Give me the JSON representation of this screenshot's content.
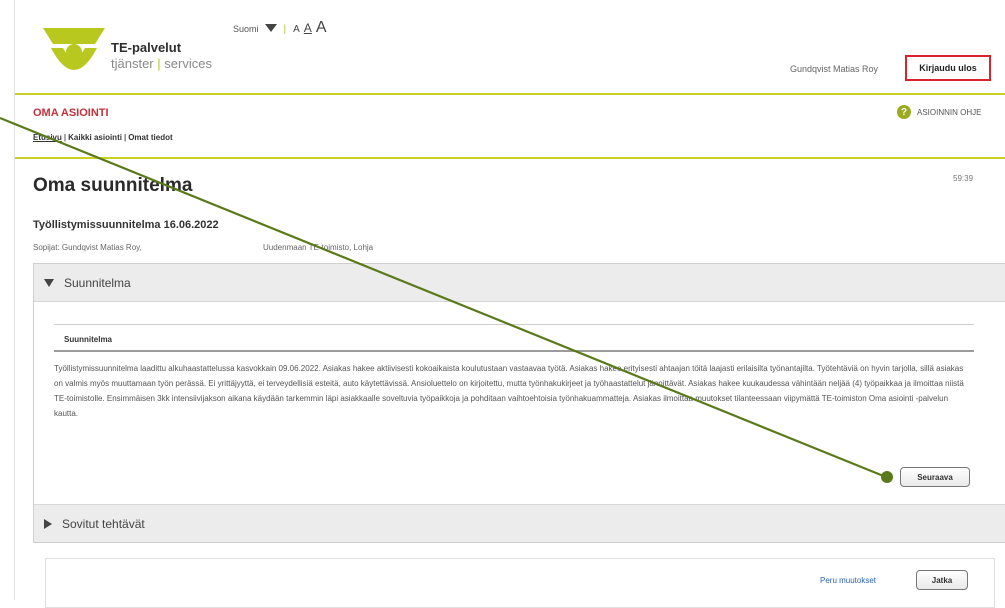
{
  "header": {
    "brand_name": "TE-palvelut",
    "brand_sub_left": "tjänster",
    "brand_sub_sep": "|",
    "brand_sub_right": "services",
    "language": "Suomi",
    "font_sizes": [
      "A",
      "A",
      "A"
    ],
    "user_name": "Gundqvist Matias Roy",
    "logout_label": "Kirjaudu ulos"
  },
  "section": {
    "title": "OMA ASIOINTI",
    "help_label": "ASIOINNIN OHJE"
  },
  "nav": {
    "items": [
      "Etusivu",
      "Kaikki asiointi",
      "Omat tiedot"
    ],
    "separator": "|"
  },
  "main": {
    "page_title": "Oma suunnitelma",
    "timer": "59:39",
    "plan_title": "Työllistymissuunnitelma 16.06.2022",
    "parties": "Sopijat: Gundqvist Matias Roy,",
    "office": "Uudenmaan TE-toimisto, Lohja"
  },
  "accordion": {
    "first_label": "Suunnitelma",
    "inner_heading": "Suunnitelma",
    "text": "Työllistymissuunnitelma laadittu alkuhaastattelussa kasvokkain 09.06.2022. Asiakas hakee aktiivisesti kokoaikaista koulutustaan vastaavaa työtä. Asiakas hakee erityisesti ahtaajan töitä laajasti erilaisilta työnantajilta. Työtehtäviä on hyvin tarjolla, sillä asiakas on valmis myös muuttamaan työn perässä. Ei yrittäjyyttä, ei terveydellisiä esteitä, auto käytettävissä. Ansioluettelo on kirjoitettu, mutta työnhakukirjeet ja työhaastattelut jännittävät. Asiakas hakee kuukaudessa vähintään neljää (4) työpaikkaa ja ilmoittaa niistä TE-toimistolle. Ensimmäisen 3kk intensiivijakson aikana käydään tarkemmin läpi asiakkaalle soveltuvia työpaikkoja ja pohditaan vaihtoehtoisia työnhakuammatteja. Asiakas ilmoittaa muutokset tilanteessaan viipymättä TE-toimiston Oma asiointi -palvelun kautta.",
    "next_label": "Seuraava",
    "second_label": "Sovitut tehtävät"
  },
  "footer": {
    "cancel_label": "Peru muutokset",
    "continue_label": "Jatka"
  },
  "colors": {
    "accent_green": "#c6d21f",
    "logout_red": "#d9242f",
    "section_red": "#c3313a",
    "annotation_green": "#5a7a1a"
  }
}
